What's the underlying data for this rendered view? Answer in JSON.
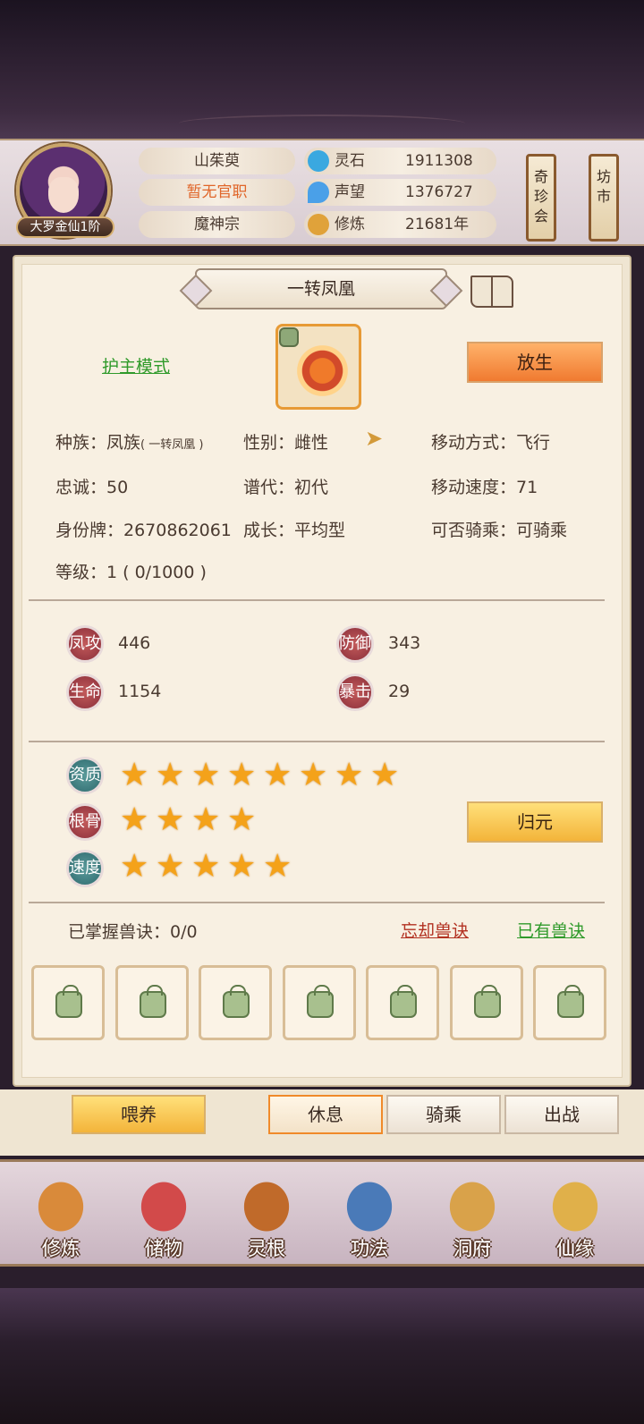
{
  "player": {
    "rank_badge": "大罗金仙1阶",
    "name": "山茱萸",
    "official_title": "暂无官职",
    "sect": "魔神宗"
  },
  "resources": [
    {
      "label": "灵石",
      "value": "1911308",
      "icon": "spirit-stone-icon",
      "color": "#3aa8e0"
    },
    {
      "label": "声望",
      "value": "1376727",
      "icon": "prestige-icon",
      "color": "#4aa0e8"
    },
    {
      "label": "修炼",
      "value": "21681年",
      "icon": "meditation-icon",
      "color": "#e0a23a"
    }
  ],
  "side_tags": [
    {
      "chars": [
        "奇",
        "珍",
        "会"
      ]
    },
    {
      "chars": [
        "坊",
        "市"
      ]
    }
  ],
  "pet": {
    "title": "一转凤凰",
    "mode": "护主模式",
    "release_label": "放生",
    "info": {
      "race_label": "种族：",
      "race_value": "凤族",
      "race_sub": "( 一转凤凰 )",
      "gender": "性别：雌性",
      "move_type": "移动方式：飞行",
      "loyalty": "忠诚：50",
      "generation": "谱代：初代",
      "move_speed": "移动速度：71",
      "id_tag": "身份牌：2670862061",
      "growth": "成长：平均型",
      "rideable": "可否骑乘：可骑乘",
      "level": "等级：1 ( 0/1000 )"
    },
    "stats": [
      {
        "badge": "凤攻",
        "value": "446"
      },
      {
        "badge": "防御",
        "value": "343"
      },
      {
        "badge": "生命",
        "value": "1154"
      },
      {
        "badge": "暴击",
        "value": "29"
      }
    ],
    "ratings": [
      {
        "badge": "资质",
        "stars": 8
      },
      {
        "badge": "根骨",
        "stars": 4
      },
      {
        "badge": "速度",
        "stars": 5
      }
    ],
    "reset_label": "归元",
    "skills": {
      "mastered": "已掌握兽诀：0/0",
      "forget_label": "忘却兽诀",
      "owned_label": "已有兽诀",
      "slot_count": 7
    }
  },
  "actions": {
    "feed": "喂养",
    "rest": "休息",
    "ride": "骑乘",
    "battle": "出战"
  },
  "nav": [
    {
      "label": "修炼",
      "icon": "cultivate-icon",
      "color": "#d98a3a"
    },
    {
      "label": "储物",
      "icon": "storage-bag-icon",
      "color": "#d24a4a"
    },
    {
      "label": "灵根",
      "icon": "spirit-root-icon",
      "color": "#c06a2a"
    },
    {
      "label": "功法",
      "icon": "technique-book-icon",
      "color": "#4a7ab8"
    },
    {
      "label": "洞府",
      "icon": "cave-house-icon",
      "color": "#d9a24a"
    },
    {
      "label": "仙缘",
      "icon": "gourd-icon",
      "color": "#e0b04a"
    }
  ]
}
